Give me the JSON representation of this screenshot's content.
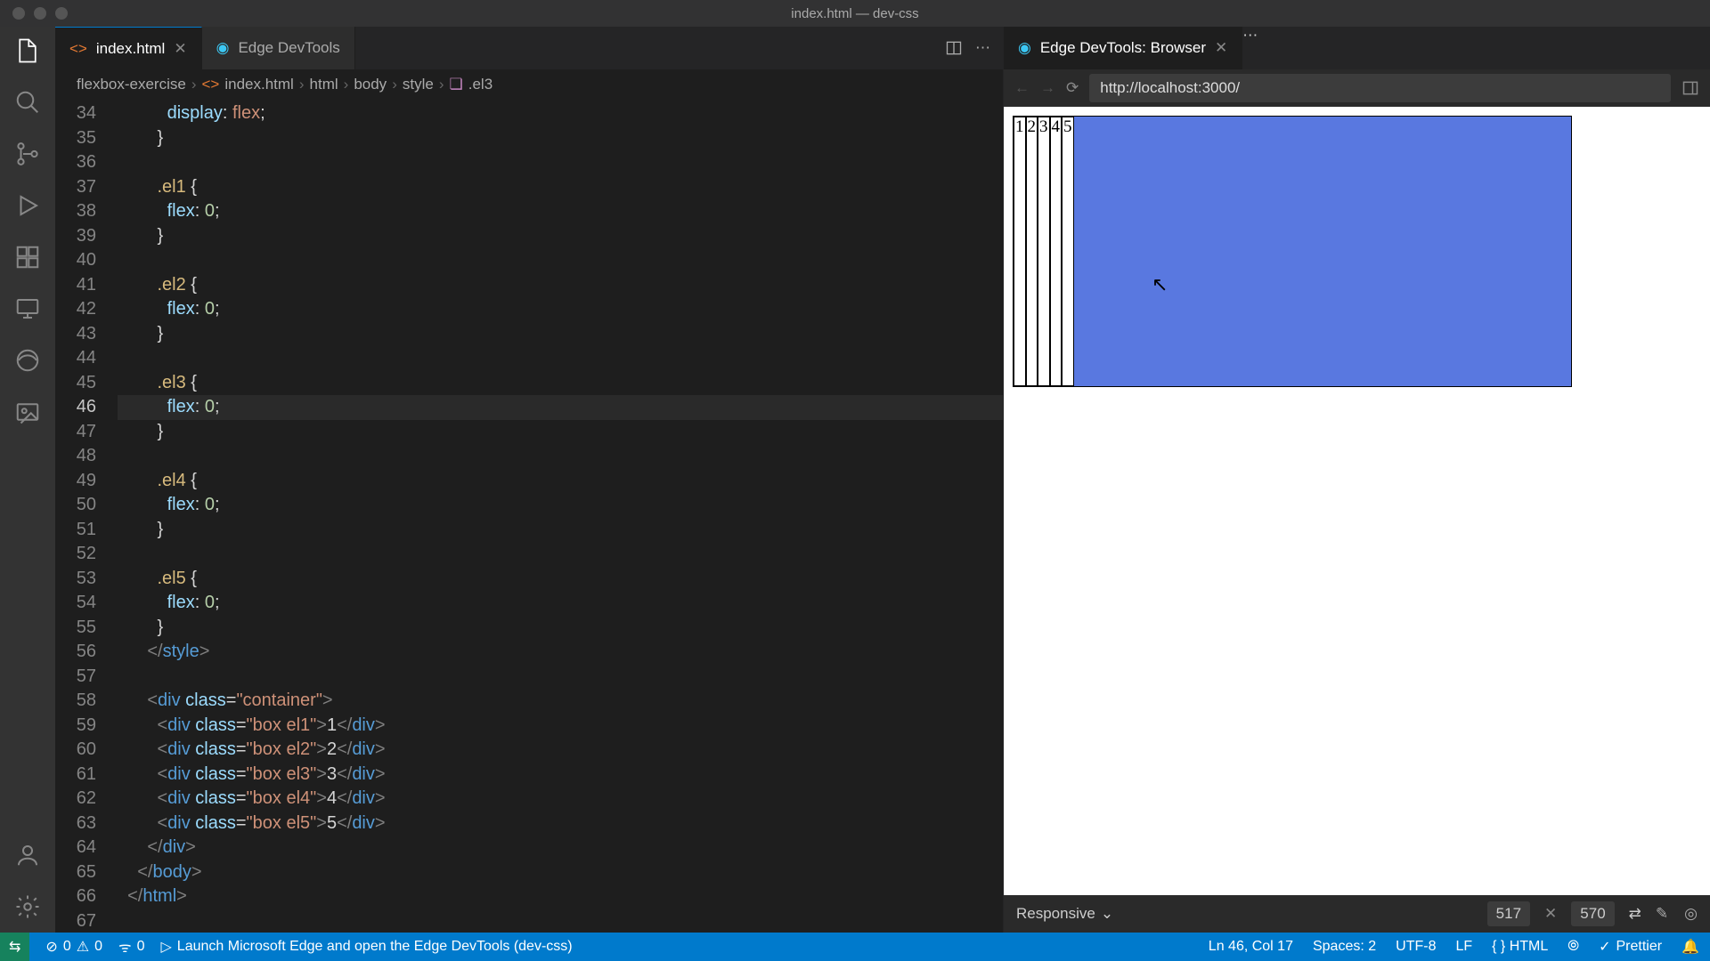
{
  "window_title": "index.html — dev-css",
  "activity_icons": [
    "files",
    "search",
    "git",
    "debug",
    "extensions",
    "remote",
    "edge",
    "image"
  ],
  "activity_bottom": [
    "account",
    "settings"
  ],
  "tabs_left": [
    {
      "label": "index.html",
      "icon": "html",
      "active": true,
      "dirty": false
    },
    {
      "label": "Edge DevTools",
      "icon": "edge",
      "active": false
    }
  ],
  "tabs_right": [
    {
      "label": "Edge DevTools: Browser",
      "icon": "edge",
      "active": true
    }
  ],
  "breadcrumb": {
    "project": "flexbox-exercise",
    "file": "index.html",
    "path": [
      "html",
      "body",
      "style"
    ],
    "leaf": ".el3"
  },
  "gutter_start": 34,
  "current_line": 46,
  "code_lines": [
    {
      "n": 34,
      "html": "          <span class='prop'>display</span><span class='pun'>:</span> <span class='kw'>flex</span><span class='pun'>;</span>"
    },
    {
      "n": 35,
      "html": "        <span class='pun'>}</span>"
    },
    {
      "n": 36,
      "html": ""
    },
    {
      "n": 37,
      "html": "        <span class='sel'>.el1</span> <span class='pun'>{</span>"
    },
    {
      "n": 38,
      "html": "          <span class='prop'>flex</span><span class='pun'>:</span> <span class='num'>0</span><span class='pun'>;</span>"
    },
    {
      "n": 39,
      "html": "        <span class='pun'>}</span>"
    },
    {
      "n": 40,
      "html": ""
    },
    {
      "n": 41,
      "html": "        <span class='sel'>.el2</span> <span class='pun'>{</span>"
    },
    {
      "n": 42,
      "html": "          <span class='prop'>flex</span><span class='pun'>:</span> <span class='num'>0</span><span class='pun'>;</span>"
    },
    {
      "n": 43,
      "html": "        <span class='pun'>}</span>"
    },
    {
      "n": 44,
      "html": ""
    },
    {
      "n": 45,
      "html": "        <span class='sel'>.el3</span> <span class='pun'>{</span>"
    },
    {
      "n": 46,
      "html": "          <span class='prop'>flex</span><span class='pun'>:</span> <span class='num'>0</span><span class='pun'>;</span>"
    },
    {
      "n": 47,
      "html": "        <span class='pun'>}</span>"
    },
    {
      "n": 48,
      "html": ""
    },
    {
      "n": 49,
      "html": "        <span class='sel'>.el4</span> <span class='pun'>{</span>"
    },
    {
      "n": 50,
      "html": "          <span class='prop'>flex</span><span class='pun'>:</span> <span class='num'>0</span><span class='pun'>;</span>"
    },
    {
      "n": 51,
      "html": "        <span class='pun'>}</span>"
    },
    {
      "n": 52,
      "html": ""
    },
    {
      "n": 53,
      "html": "        <span class='sel'>.el5</span> <span class='pun'>{</span>"
    },
    {
      "n": 54,
      "html": "          <span class='prop'>flex</span><span class='pun'>:</span> <span class='num'>0</span><span class='pun'>;</span>"
    },
    {
      "n": 55,
      "html": "        <span class='pun'>}</span>"
    },
    {
      "n": 56,
      "html": "      <span class='brk'>&lt;/</span><span class='tag'>style</span><span class='brk'>&gt;</span>"
    },
    {
      "n": 57,
      "html": ""
    },
    {
      "n": 58,
      "html": "      <span class='brk'>&lt;</span><span class='tag'>div</span> <span class='attr'>class</span>=<span class='str'>\"container\"</span><span class='brk'>&gt;</span>"
    },
    {
      "n": 59,
      "html": "        <span class='brk'>&lt;</span><span class='tag'>div</span> <span class='attr'>class</span>=<span class='str'>\"box el1\"</span><span class='brk'>&gt;</span>1<span class='brk'>&lt;/</span><span class='tag'>div</span><span class='brk'>&gt;</span>"
    },
    {
      "n": 60,
      "html": "        <span class='brk'>&lt;</span><span class='tag'>div</span> <span class='attr'>class</span>=<span class='str'>\"box el2\"</span><span class='brk'>&gt;</span>2<span class='brk'>&lt;/</span><span class='tag'>div</span><span class='brk'>&gt;</span>"
    },
    {
      "n": 61,
      "html": "        <span class='brk'>&lt;</span><span class='tag'>div</span> <span class='attr'>class</span>=<span class='str'>\"box el3\"</span><span class='brk'>&gt;</span>3<span class='brk'>&lt;/</span><span class='tag'>div</span><span class='brk'>&gt;</span>"
    },
    {
      "n": 62,
      "html": "        <span class='brk'>&lt;</span><span class='tag'>div</span> <span class='attr'>class</span>=<span class='str'>\"box el4\"</span><span class='brk'>&gt;</span>4<span class='brk'>&lt;/</span><span class='tag'>div</span><span class='brk'>&gt;</span>"
    },
    {
      "n": 63,
      "html": "        <span class='brk'>&lt;</span><span class='tag'>div</span> <span class='attr'>class</span>=<span class='str'>\"box el5\"</span><span class='brk'>&gt;</span>5<span class='brk'>&lt;/</span><span class='tag'>div</span><span class='brk'>&gt;</span>"
    },
    {
      "n": 64,
      "html": "      <span class='brk'>&lt;/</span><span class='tag'>div</span><span class='brk'>&gt;</span>"
    },
    {
      "n": 65,
      "html": "    <span class='brk'>&lt;/</span><span class='tag'>body</span><span class='brk'>&gt;</span>"
    },
    {
      "n": 66,
      "html": "  <span class='brk'>&lt;/</span><span class='tag'>html</span><span class='brk'>&gt;</span>"
    },
    {
      "n": 67,
      "html": ""
    }
  ],
  "nav": {
    "url": "http://localhost:3000/"
  },
  "flex_boxes": [
    "1",
    "2",
    "3",
    "4",
    "5"
  ],
  "devtool_bar": {
    "mode": "Responsive",
    "w": "517",
    "h": "570"
  },
  "status": {
    "remote_icon": "⇆",
    "errors": "0",
    "warnings": "0",
    "ports": "0",
    "launch": "Launch Microsoft Edge and open the Edge DevTools (dev-css)",
    "cursor": "Ln 46, Col 17",
    "spaces": "Spaces: 2",
    "encoding": "UTF-8",
    "eol": "LF",
    "lang": "HTML",
    "prettier": "Prettier"
  }
}
